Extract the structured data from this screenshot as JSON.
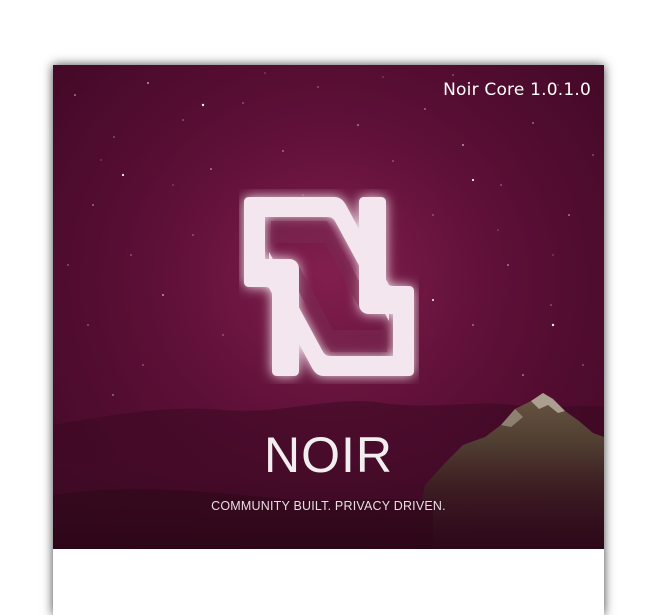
{
  "splash": {
    "version": "Noir Core 1.0.1.0",
    "brand_name": "NOIR",
    "tagline": "COMMUNITY BUILT. PRIVACY DRIVEN."
  },
  "colors": {
    "background_primary": "#5e0f37",
    "background_dark": "#3e0824",
    "logo_fill": "#f3e6ee",
    "text": "#ffffff"
  },
  "icons": {
    "logo": "noir-n-logo-icon"
  }
}
